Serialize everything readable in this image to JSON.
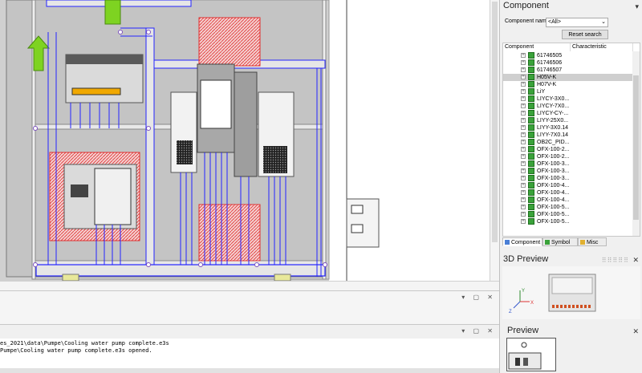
{
  "component_panel": {
    "title": "Component",
    "name_label": "Component name",
    "name_value": "<All>",
    "reset_label": "Reset search",
    "columns": [
      "Component",
      "Characteristic"
    ],
    "items": [
      "61746505",
      "61746506",
      "61746507",
      "H05V-K",
      "H07V-K",
      "LiY",
      "LIYCY-3X0...",
      "LIYCY-7X0...",
      "LIYCY-CY-...",
      "LIYY-25X0...",
      "LIYY-3X0.14",
      "LIYY-7X0.14",
      "OB2C_PID...",
      "OFX-100-2...",
      "OFX-100-2...",
      "OFX-100-3...",
      "OFX-100-3...",
      "OFX-100-3...",
      "OFX-100-4...",
      "OFX-100-4...",
      "OFX-100-4...",
      "OFX-100-5...",
      "OFX-100-5...",
      "OFX-100-5..."
    ],
    "selected_index": 3,
    "tabs": [
      "Component",
      "Symbol",
      "Misc"
    ]
  },
  "preview3d": {
    "title": "3D Preview"
  },
  "preview": {
    "title": "Preview"
  },
  "output": {
    "lines": [
      "es_2021\\data\\Pumpe\\Cooling water pump complete.e3s",
      "Pumpe\\Cooling water pump complete.e3s opened."
    ]
  },
  "axes": {
    "x": "X",
    "y": "Y",
    "z": "Z"
  },
  "colors": {
    "wire": "#2424ff",
    "hatch": "#e03030",
    "arrow": "#7ed321",
    "module": "#dadada"
  }
}
